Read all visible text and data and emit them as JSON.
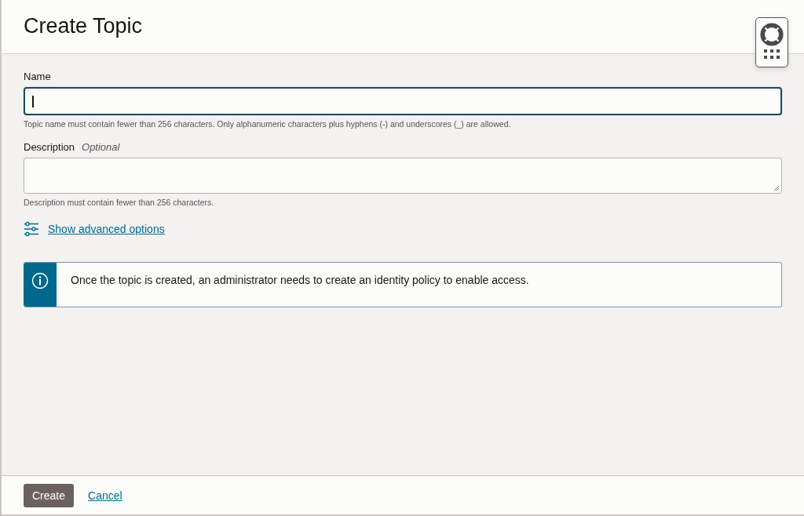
{
  "dialog": {
    "title": "Create Topic"
  },
  "fields": [
    {
      "kind": "input",
      "label": "Name",
      "focused": true,
      "help": "Topic name must contain fewer than 256 characters. Only alphanumeric characters plus hyphens (-) and underscores (_) are allowed."
    },
    {
      "kind": "textarea",
      "label": "Description",
      "optional_tag": "Optional",
      "focused": false,
      "help": "Description must contain fewer than 256 characters."
    }
  ],
  "advanced_link": "Show advanced options",
  "info_banner": {
    "text": "Once the topic is created, an administrator needs to create an identity policy to enable access."
  },
  "footer": {
    "primary_button": "Create",
    "cancel_link": "Cancel"
  }
}
